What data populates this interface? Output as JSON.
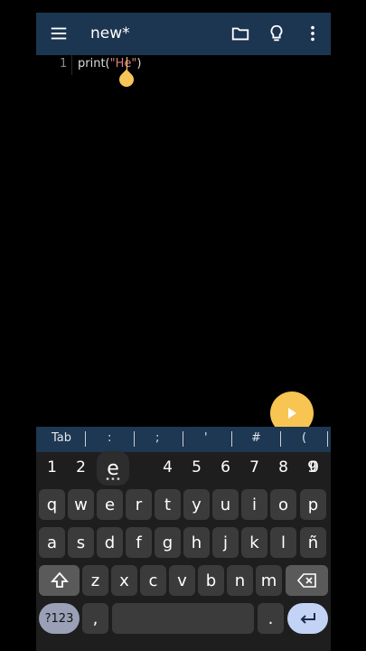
{
  "app": {
    "title": "new*"
  },
  "editor": {
    "line_number": "1",
    "code_prefix": "print(",
    "code_string": "\"He\"",
    "code_suffix": ")"
  },
  "symbols": [
    "Tab",
    ":",
    ";",
    "'",
    "#",
    "("
  ],
  "keyboard": {
    "number_row": [
      "1",
      "2",
      "e",
      "4",
      "5",
      "6",
      "7",
      "8",
      "9",
      "0"
    ],
    "row1": [
      "q",
      "w",
      "e",
      "r",
      "t",
      "y",
      "u",
      "i",
      "o",
      "p"
    ],
    "row2": [
      "a",
      "s",
      "d",
      "f",
      "g",
      "h",
      "j",
      "k",
      "l",
      "ñ"
    ],
    "row3": [
      "z",
      "x",
      "c",
      "v",
      "b",
      "n",
      "m"
    ],
    "sym_label": "?123",
    "comma": ",",
    "period": "."
  },
  "colors": {
    "appbar": "#1c3551",
    "fab": "#f8c452"
  }
}
